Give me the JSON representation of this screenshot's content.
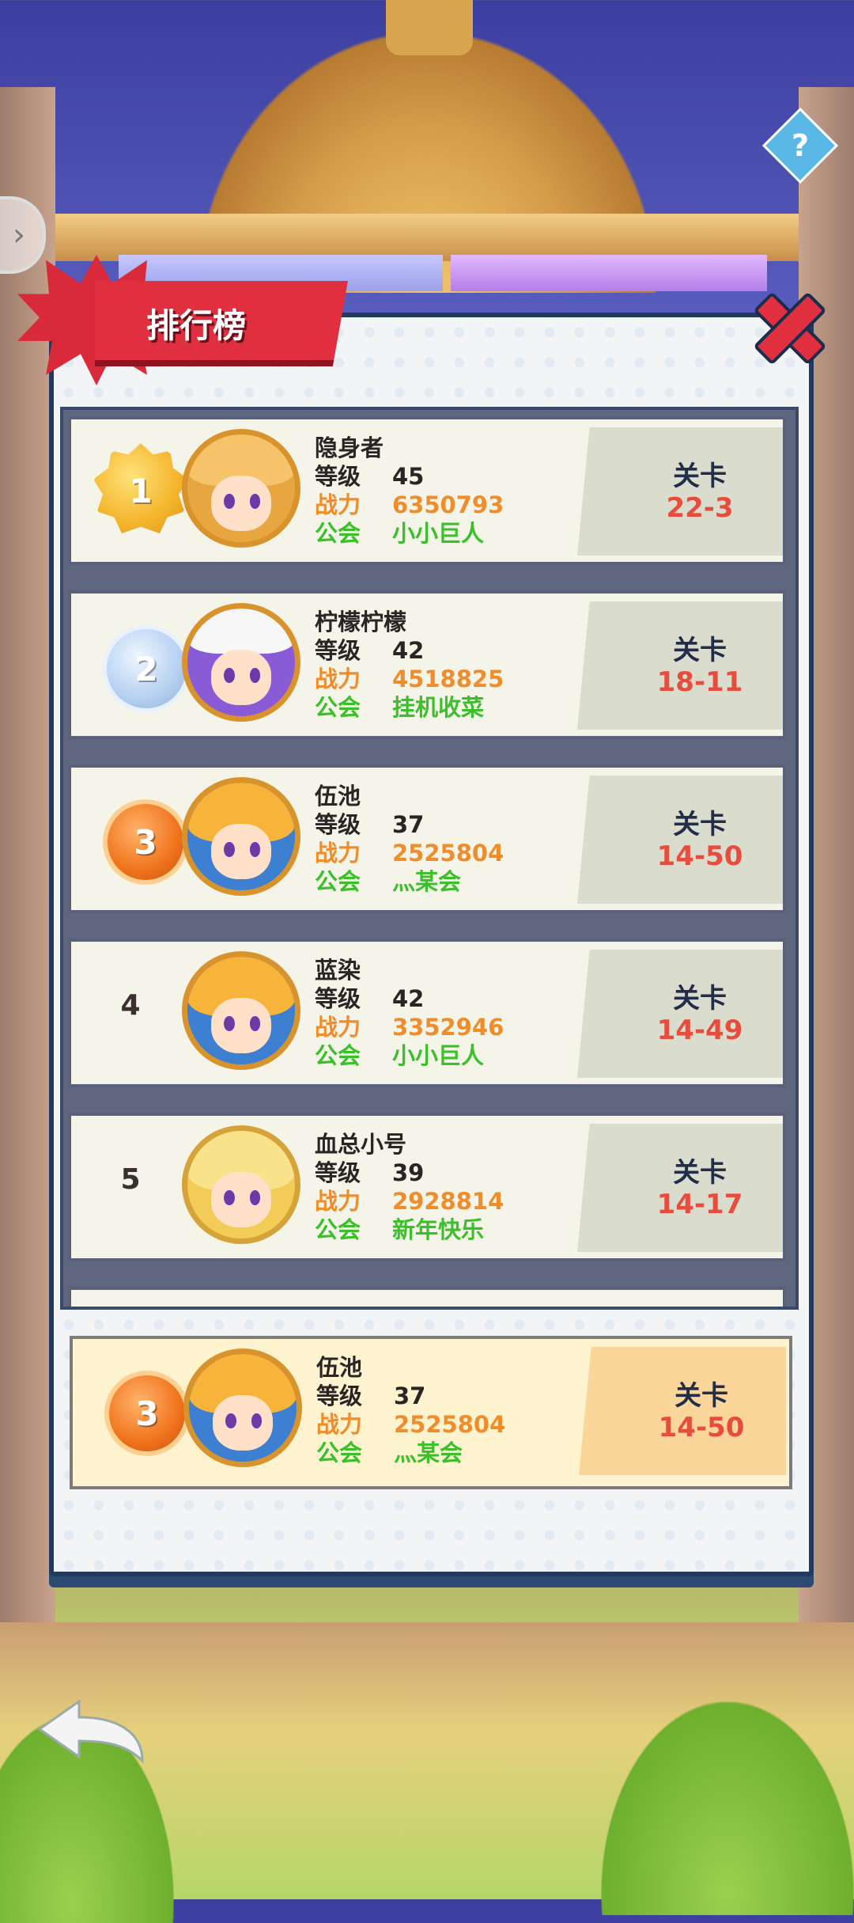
{
  "title": "排行榜",
  "stage_label": "关卡",
  "labels": {
    "level": "等级",
    "power": "战力",
    "guild": "公会"
  },
  "icons": {
    "close": "close-icon",
    "back": "back-arrow-icon",
    "help": "help-icon"
  },
  "colors": {
    "power": "#f08c2a",
    "guild": "#3bbf2b",
    "stage_value": "#e74c3c"
  },
  "rankings": [
    {
      "rank": "1",
      "badge": "gold",
      "name": "隐身者",
      "level": "45",
      "power": "6350793",
      "guild": "小小巨人",
      "stage": "22-3",
      "avatar": "lion"
    },
    {
      "rank": "2",
      "badge": "silver",
      "name": "柠檬柠檬",
      "level": "42",
      "power": "4518825",
      "guild": "挂机收菜",
      "stage": "18-11",
      "avatar": "bear"
    },
    {
      "rank": "3",
      "badge": "bronze",
      "name": "伍池",
      "level": "37",
      "power": "2525804",
      "guild": "灬某会",
      "stage": "14-50",
      "avatar": "boy"
    },
    {
      "rank": "4",
      "badge": "",
      "name": "蓝染",
      "level": "42",
      "power": "3352946",
      "guild": "小小巨人",
      "stage": "14-49",
      "avatar": "boy"
    },
    {
      "rank": "5",
      "badge": "",
      "name": "血总小号",
      "level": "39",
      "power": "2928814",
      "guild": "新年快乐",
      "stage": "14-17",
      "avatar": "crown"
    }
  ],
  "self": {
    "rank": "3",
    "name": "伍池",
    "level": "37",
    "power": "2525804",
    "guild": "灬某会",
    "stage": "14-50"
  }
}
